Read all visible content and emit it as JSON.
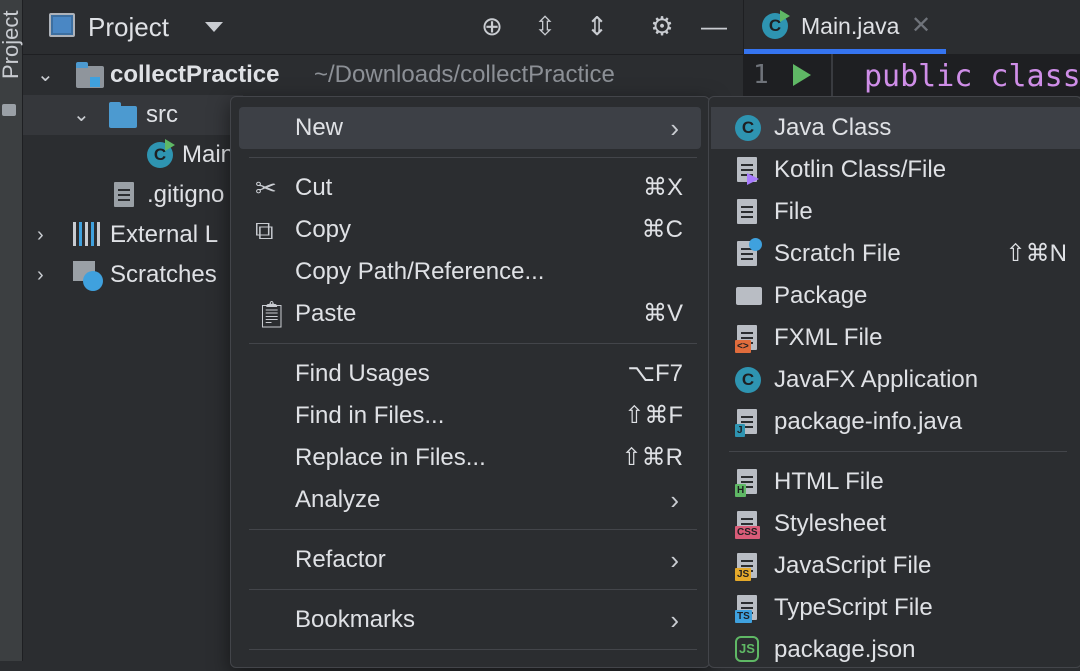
{
  "side_strip": {
    "label": "Project"
  },
  "project_panel": {
    "title": "Project",
    "icons": [
      "crosshair-icon",
      "expand-all-icon",
      "collapse-all-icon",
      "gear-icon",
      "minimize-icon"
    ]
  },
  "tree": {
    "root_name": "collectPractice",
    "root_path": "~/Downloads/collectPractice",
    "src": "src",
    "main": "Main",
    "gitignore": ".gitigno",
    "external": "External L",
    "scratches": "Scratches"
  },
  "editor": {
    "tab_label": "Main.java",
    "line_number": "1",
    "code": "public class"
  },
  "context_menu": {
    "new": "New",
    "cut": {
      "label": "Cut",
      "shortcut": "⌘X"
    },
    "copy": {
      "label": "Copy",
      "shortcut": "⌘C"
    },
    "copy_path": "Copy Path/Reference...",
    "paste": {
      "label": "Paste",
      "shortcut": "⌘V"
    },
    "find_usages": {
      "label": "Find Usages",
      "shortcut": "⌥F7"
    },
    "find_in_files": {
      "label": "Find in Files...",
      "shortcut": "⇧⌘F"
    },
    "replace_in_files": {
      "label": "Replace in Files...",
      "shortcut": "⇧⌘R"
    },
    "analyze": "Analyze",
    "refactor": "Refactor",
    "bookmarks": "Bookmarks"
  },
  "new_submenu": {
    "java_class": "Java Class",
    "kotlin": "Kotlin Class/File",
    "file": "File",
    "scratch": {
      "label": "Scratch File",
      "shortcut": "⇧⌘N"
    },
    "package": "Package",
    "fxml": "FXML File",
    "javafx": "JavaFX Application",
    "package_info": "package-info.java",
    "html": "HTML File",
    "stylesheet": "Stylesheet",
    "javascript": "JavaScript File",
    "typescript": "TypeScript File",
    "package_json": "package.json"
  },
  "colors": {
    "accent": "#3574f0",
    "background": "#2b2d30",
    "selection": "#3d4046",
    "java_icon": "#2e94b1",
    "folder": "#4c9ad0",
    "keyword": "#cf8ee8"
  }
}
